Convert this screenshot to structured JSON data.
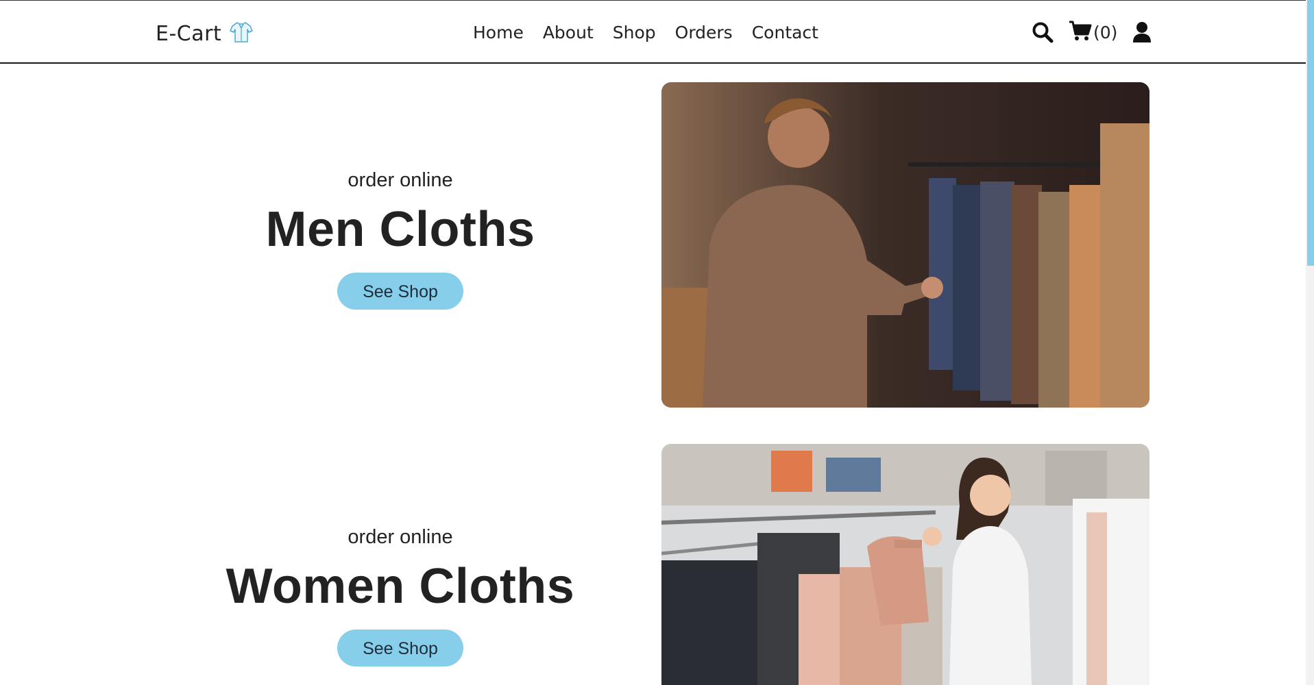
{
  "header": {
    "brand": "E-Cart",
    "nav": [
      "Home",
      "About",
      "Shop",
      "Orders",
      "Contact"
    ],
    "cart_count": "(0)",
    "icons": [
      "shirt-icon",
      "search-icon",
      "cart-icon",
      "user-icon"
    ]
  },
  "sections": [
    {
      "eyebrow": "order online",
      "headline": "Men Cloths",
      "cta": "See Shop"
    },
    {
      "eyebrow": "order online",
      "headline": "Women Cloths",
      "cta": "See Shop"
    }
  ],
  "colors": {
    "accent": "#87ceeb",
    "text": "#222222",
    "border": "#1a1a1a"
  }
}
